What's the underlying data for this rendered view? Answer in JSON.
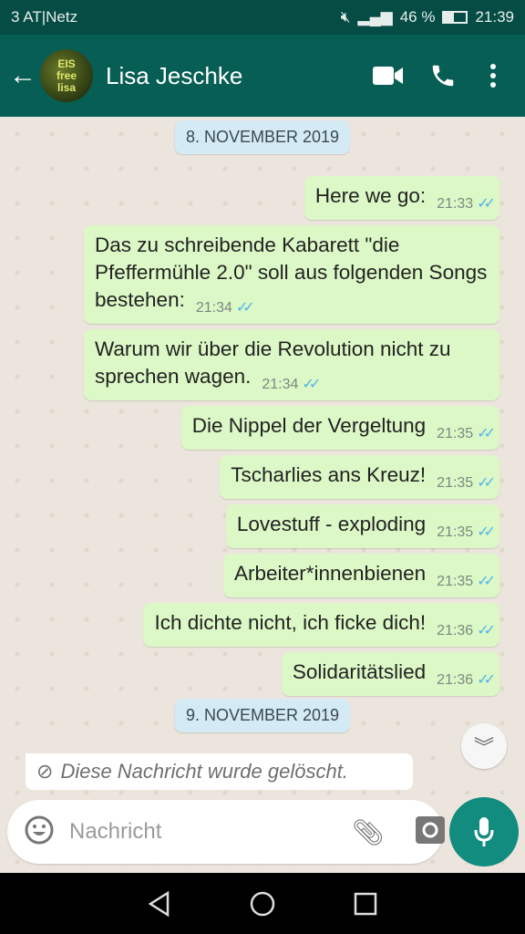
{
  "status_bar": {
    "carrier": "3 AT|Netz",
    "battery": "46 %",
    "time": "21:39"
  },
  "header": {
    "contact_name": "Lisa Jeschke",
    "avatar_text": "EIS free lisa"
  },
  "chat": {
    "date1": "8. NOVEMBER 2019",
    "messages": [
      {
        "text": "Here we go:",
        "time": "21:33"
      },
      {
        "text": "Das zu schreibende Kabarett \"die Pfeffermühle 2.0\" soll aus folgenden Songs bestehen:",
        "time": "21:34"
      },
      {
        "text": "Warum wir über die Revolution nicht zu sprechen wagen.",
        "time": "21:34"
      },
      {
        "text": "Die Nippel der Vergeltung",
        "time": "21:35"
      },
      {
        "text": "Tscharlies ans Kreuz!",
        "time": "21:35"
      },
      {
        "text": "Lovestuff - exploding",
        "time": "21:35"
      },
      {
        "text": "Arbeiter*innenbienen",
        "time": "21:35"
      },
      {
        "text": "Ich dichte nicht, ich ficke dich!",
        "time": "21:36"
      },
      {
        "text": "Solidaritätslied",
        "time": "21:36"
      }
    ],
    "date2": "9. NOVEMBER 2019",
    "deleted_text": "Diese Nachricht wurde gelöscht."
  },
  "composer": {
    "placeholder": "Nachricht"
  },
  "colors": {
    "header": "#075e54",
    "outgoing": "#dcf8c6",
    "accent": "#128c7e",
    "read_tick": "#4fb6ec"
  }
}
